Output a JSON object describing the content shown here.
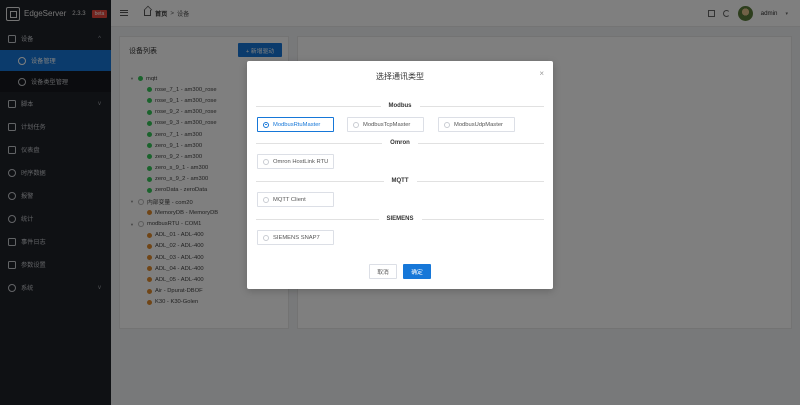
{
  "app": {
    "name": "EdgeServer",
    "version": "2.3.3",
    "badge": "beta"
  },
  "sidebar": {
    "items": [
      {
        "label": "设备",
        "chevron": "^"
      },
      {
        "label": "设备管理"
      },
      {
        "label": "设备类型管理"
      },
      {
        "label": "脚本",
        "chevron": "v"
      },
      {
        "label": "计划任务"
      },
      {
        "label": "仪表盘"
      },
      {
        "label": "时序数据"
      },
      {
        "label": "报警"
      },
      {
        "label": "统计"
      },
      {
        "label": "事件日志"
      },
      {
        "label": "参数设置"
      },
      {
        "label": "系统",
        "chevron": "v"
      }
    ]
  },
  "header": {
    "breadcrumb_home": "首页",
    "breadcrumb_sep": ">",
    "breadcrumb_current": "设备",
    "user": "admin",
    "caret": "▾"
  },
  "devices_panel": {
    "title": "设备列表",
    "add_button": "+ 新增驱动",
    "tree": [
      {
        "label": "mqtt",
        "level": 0,
        "status": "green",
        "expander": "▼"
      },
      {
        "label": "rose_7_1 - am300_rose",
        "level": 1,
        "status": "green"
      },
      {
        "label": "rose_9_1 - am300_rose",
        "level": 1,
        "status": "green"
      },
      {
        "label": "rose_9_2 - am300_rose",
        "level": 1,
        "status": "green"
      },
      {
        "label": "rose_9_3 - am300_rose",
        "level": 1,
        "status": "green"
      },
      {
        "label": "zero_7_1 - am300",
        "level": 1,
        "status": "green"
      },
      {
        "label": "zero_9_1 - am300",
        "level": 1,
        "status": "green"
      },
      {
        "label": "zero_9_2 - am300",
        "level": 1,
        "status": "green"
      },
      {
        "label": "zero_s_9_1 - am300",
        "level": 1,
        "status": "green"
      },
      {
        "label": "zero_s_9_2 - am300",
        "level": 1,
        "status": "green"
      },
      {
        "label": "zeroData - zeroData",
        "level": 1,
        "status": "green"
      },
      {
        "label": "内部变量 - com20",
        "level": 0,
        "status": "gray-ring",
        "expander": "▼"
      },
      {
        "label": "MemoryDB - MemoryDB",
        "level": 1,
        "status": "orange"
      },
      {
        "label": "modbusRTU - COM1",
        "level": 0,
        "status": "gray-ring",
        "expander": "▼"
      },
      {
        "label": "ADL_01 - ADL-400",
        "level": 1,
        "status": "orange"
      },
      {
        "label": "ADL_02 - ADL-400",
        "level": 1,
        "status": "orange"
      },
      {
        "label": "ADL_03 - ADL-400",
        "level": 1,
        "status": "orange"
      },
      {
        "label": "ADL_04 - ADL-400",
        "level": 1,
        "status": "orange"
      },
      {
        "label": "ADL_05 - ADL-400",
        "level": 1,
        "status": "orange"
      },
      {
        "label": "Air - Dpurat-DBOF",
        "level": 1,
        "status": "orange"
      },
      {
        "label": "K30 - K30-Golen",
        "level": 1,
        "status": "orange"
      }
    ]
  },
  "modal": {
    "title": "选择通讯类型",
    "close": "×",
    "sections": {
      "modbus": "Modbus",
      "omron": "Omron",
      "mqtt": "MQTT",
      "siemens": "SIEMENS"
    },
    "options": {
      "modbus_rtu": "ModbusRtuMaster",
      "modbus_tcp": "ModbusTcpMaster",
      "modbus_udp": "ModbusUdpMaster",
      "omron_hostlink": "Omron HostLink RTU",
      "mqtt_client": "MQTT Client",
      "siemens_snap7": "SIEMENS SNAP7"
    },
    "selected": "ModbusRtuMaster",
    "cancel": "取消",
    "confirm": "确定"
  },
  "colors": {
    "primary": "#1677d8",
    "sidebar_bg": "#1f2229",
    "online": "#34c759",
    "offline": "#e08a2c",
    "beta": "#e6463c"
  }
}
